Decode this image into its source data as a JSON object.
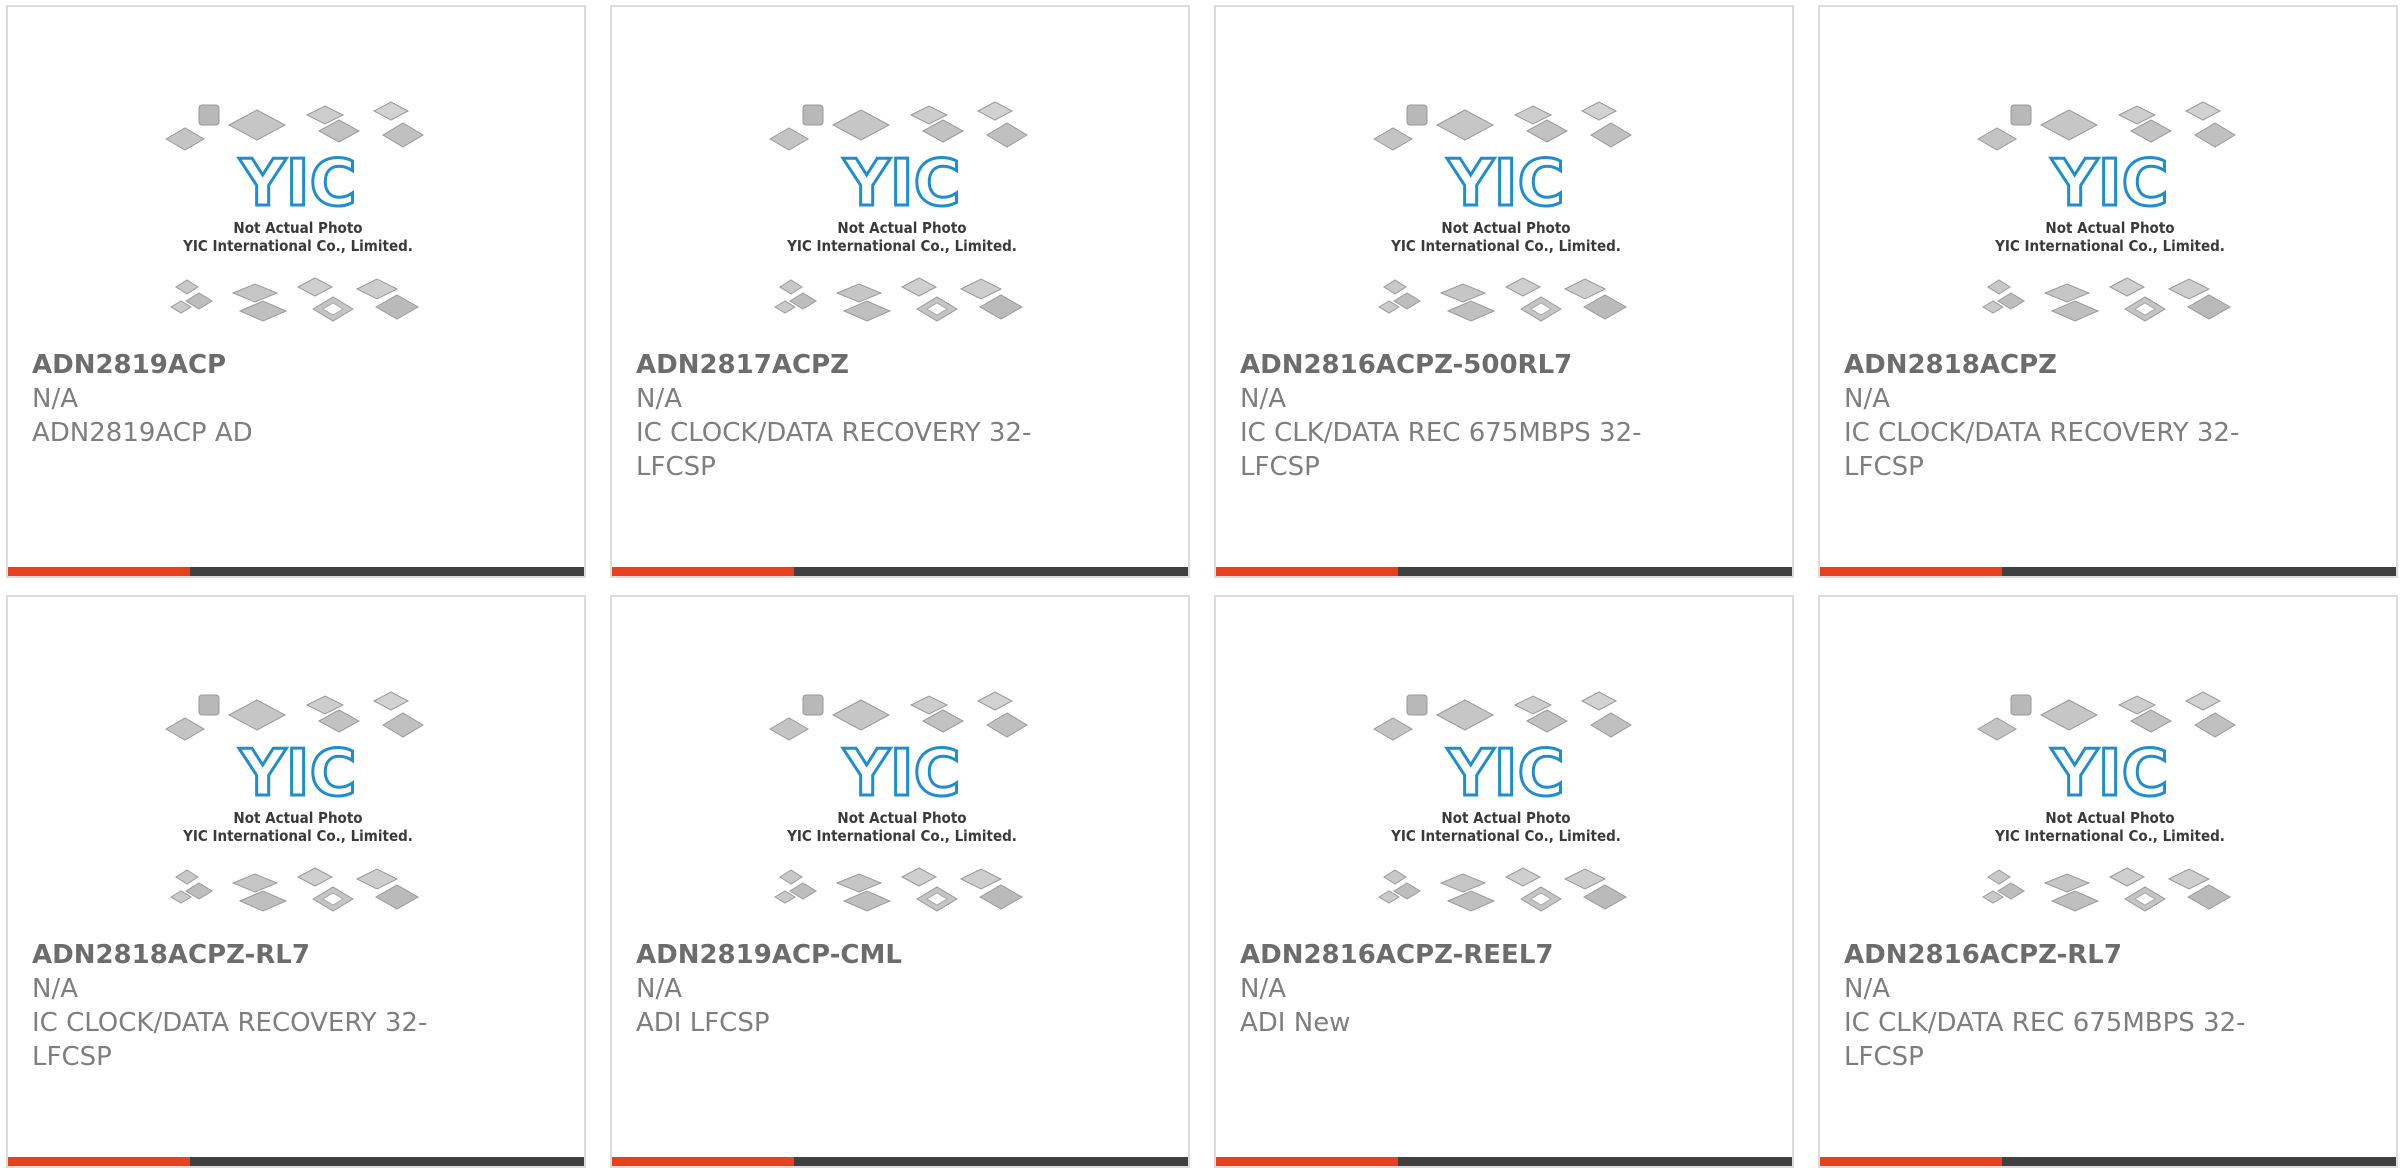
{
  "theme": {
    "accent_color": "#e8401c",
    "bar_dark_color": "#404040",
    "logo_color": "#1e8ed0"
  },
  "placeholder_image": {
    "brand": "YIC",
    "caption_line1": "Not Actual Photo",
    "caption_line2": "YIC International Co., Limited."
  },
  "products": [
    {
      "part_number": "ADN2819ACP",
      "manufacturer": "N/A",
      "description": "ADN2819ACP AD"
    },
    {
      "part_number": "ADN2817ACPZ",
      "manufacturer": "N/A",
      "description": "IC CLOCK/DATA RECOVERY 32-LFCSP"
    },
    {
      "part_number": "ADN2816ACPZ-500RL7",
      "manufacturer": "N/A",
      "description": "IC CLK/DATA REC 675MBPS 32-LFCSP"
    },
    {
      "part_number": "ADN2818ACPZ",
      "manufacturer": "N/A",
      "description": "IC CLOCK/DATA RECOVERY 32-LFCSP"
    },
    {
      "part_number": "ADN2818ACPZ-RL7",
      "manufacturer": "N/A",
      "description": "IC CLOCK/DATA RECOVERY 32-LFCSP"
    },
    {
      "part_number": "ADN2819ACP-CML",
      "manufacturer": "N/A",
      "description": "ADI LFCSP"
    },
    {
      "part_number": "ADN2816ACPZ-REEL7",
      "manufacturer": "N/A",
      "description": "ADI New"
    },
    {
      "part_number": "ADN2816ACPZ-RL7",
      "manufacturer": "N/A",
      "description": "IC CLK/DATA REC 675MBPS 32-LFCSP"
    }
  ]
}
